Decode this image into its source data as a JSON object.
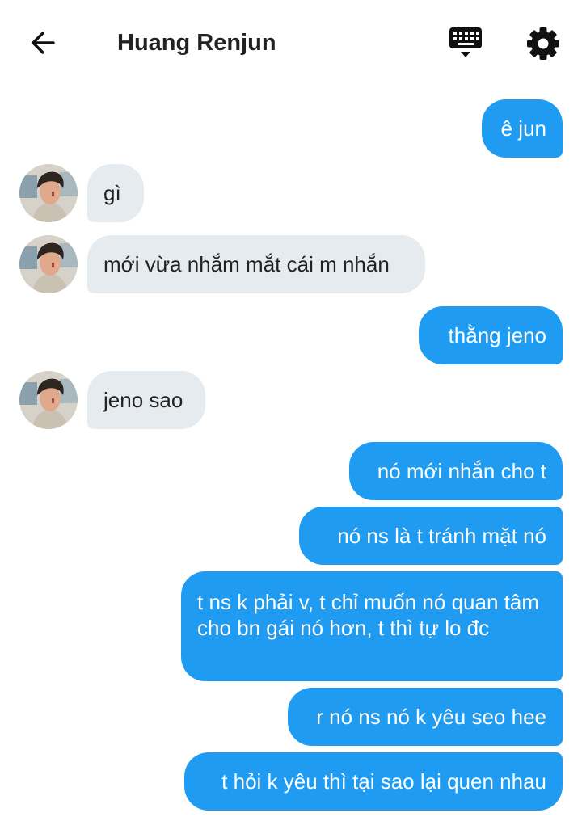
{
  "header": {
    "title": "Huang Renjun",
    "back_icon": "arrow-left-icon",
    "keyboard_icon": "keyboard-icon",
    "settings_icon": "gear-icon"
  },
  "colors": {
    "outgoing_bubble": "#1f9cf2",
    "incoming_bubble": "#e6ebef"
  },
  "messages": [
    {
      "direction": "out",
      "text": "ê jun"
    },
    {
      "direction": "in",
      "text": "gì"
    },
    {
      "direction": "in",
      "text": "mới vừa nhắm mắt cái m nhắn"
    },
    {
      "direction": "out",
      "text": "thằng jeno"
    },
    {
      "direction": "in",
      "text": "jeno sao"
    },
    {
      "direction": "out",
      "text": "nó mới nhắn cho t"
    },
    {
      "direction": "out",
      "text": "nó ns là t tránh mặt nó"
    },
    {
      "direction": "out",
      "text": "t ns k phải v, t chỉ muốn nó quan tâm cho bn gái nó hơn, t thì tự lo đc"
    },
    {
      "direction": "out",
      "text": "r nó ns nó k yêu seo hee"
    },
    {
      "direction": "out",
      "text": "t hỏi k yêu thì tại sao lại quen nhau"
    }
  ]
}
